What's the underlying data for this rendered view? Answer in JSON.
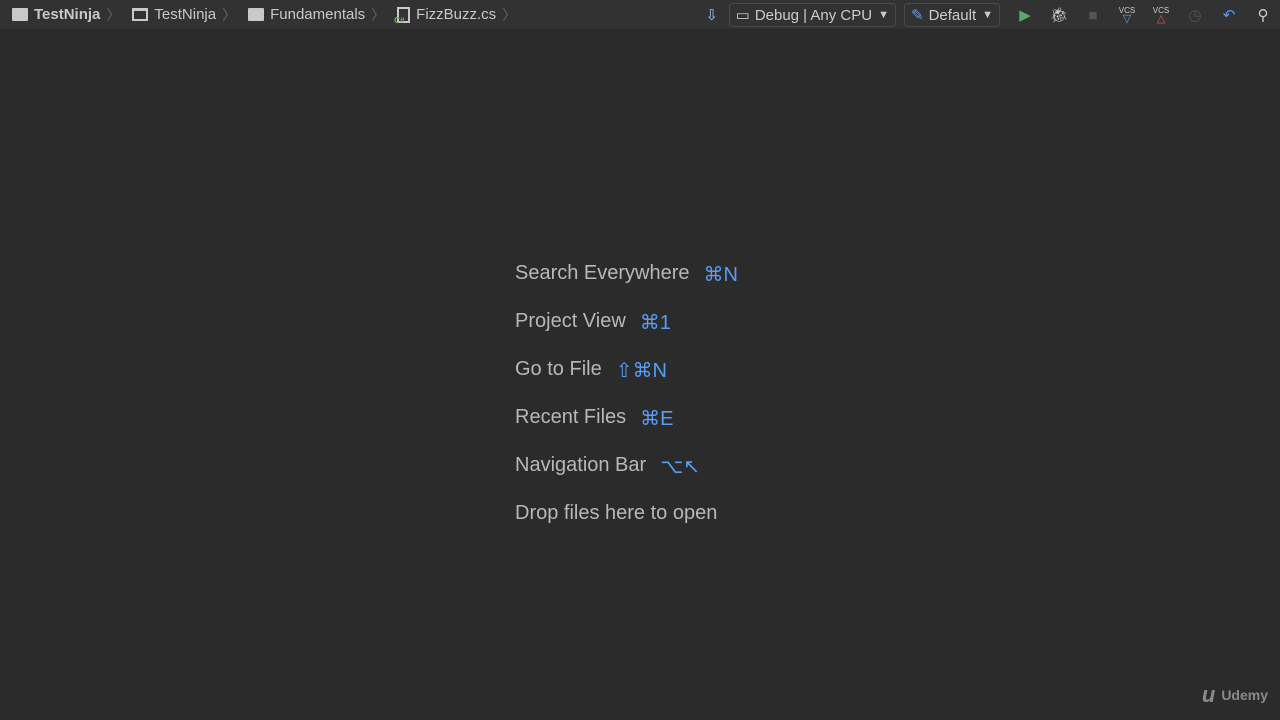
{
  "breadcrumb": [
    {
      "label": "TestNinja",
      "icon": "folder-icon",
      "bold": true
    },
    {
      "label": "TestNinja",
      "icon": "window-icon"
    },
    {
      "label": "Fundamentals",
      "icon": "folder-icon"
    },
    {
      "label": "FizzBuzz.cs",
      "icon": "csharp-file-icon"
    }
  ],
  "toolbar": {
    "config": "Debug | Any CPU",
    "target": "Default",
    "vcs": "VCS"
  },
  "hints": [
    {
      "label": "Search Everywhere",
      "key": "⌘N"
    },
    {
      "label": "Project View",
      "key": "⌘1"
    },
    {
      "label": "Go to File",
      "key": "⇧⌘N"
    },
    {
      "label": "Recent Files",
      "key": "⌘E"
    },
    {
      "label": "Navigation Bar",
      "key": "⌥↖"
    }
  ],
  "drop": "Drop files here to open",
  "watermark": "Udemy",
  "colors": {
    "accent": "#589df6",
    "run": "#59a869"
  }
}
